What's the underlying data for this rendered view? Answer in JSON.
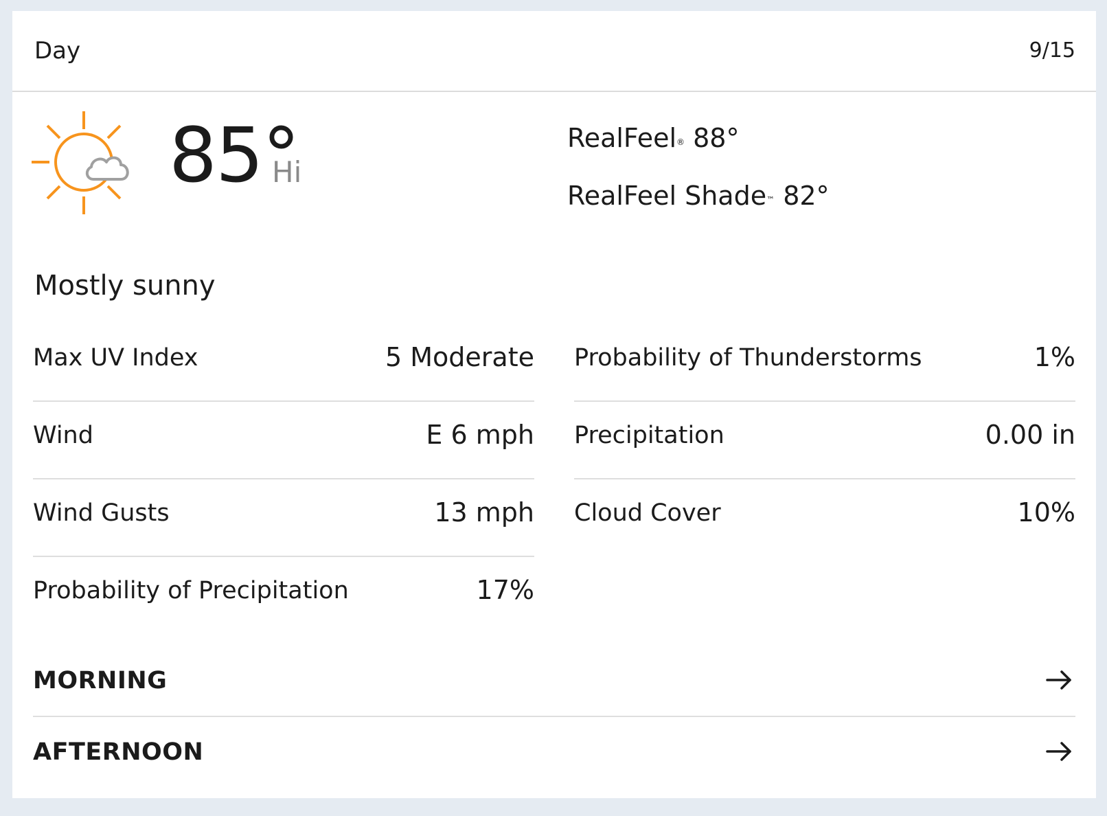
{
  "header": {
    "title": "Day",
    "date": "9/15"
  },
  "current": {
    "icon": "mostly-sunny-icon",
    "temperature": "85°",
    "temperature_label": "Hi",
    "realfeel_label": "RealFeel",
    "realfeel_mark": "®",
    "realfeel_value": "88°",
    "realfeel_shade_label": "RealFeel Shade",
    "realfeel_shade_mark": "™",
    "realfeel_shade_value": "82°",
    "condition": "Mostly sunny"
  },
  "details": {
    "left": [
      {
        "label": "Max UV Index",
        "value": "5 Moderate"
      },
      {
        "label": "Wind",
        "value": "E 6 mph"
      },
      {
        "label": "Wind Gusts",
        "value": "13 mph"
      },
      {
        "label": "Probability of Precipitation",
        "value": "17%"
      }
    ],
    "right": [
      {
        "label": "Probability of Thunderstorms",
        "value": "1%"
      },
      {
        "label": "Precipitation",
        "value": "0.00 in"
      },
      {
        "label": "Cloud Cover",
        "value": "10%"
      }
    ]
  },
  "periods": [
    {
      "label": "MORNING",
      "icon": "arrow-right-icon"
    },
    {
      "label": "AFTERNOON",
      "icon": "arrow-right-icon"
    }
  ],
  "colors": {
    "background": "#e5ebf2",
    "card": "#ffffff",
    "sun": "#f7941d",
    "cloud": "#a0a0a0",
    "divider": "#dedede",
    "secondary_text": "#8a8a8a"
  }
}
